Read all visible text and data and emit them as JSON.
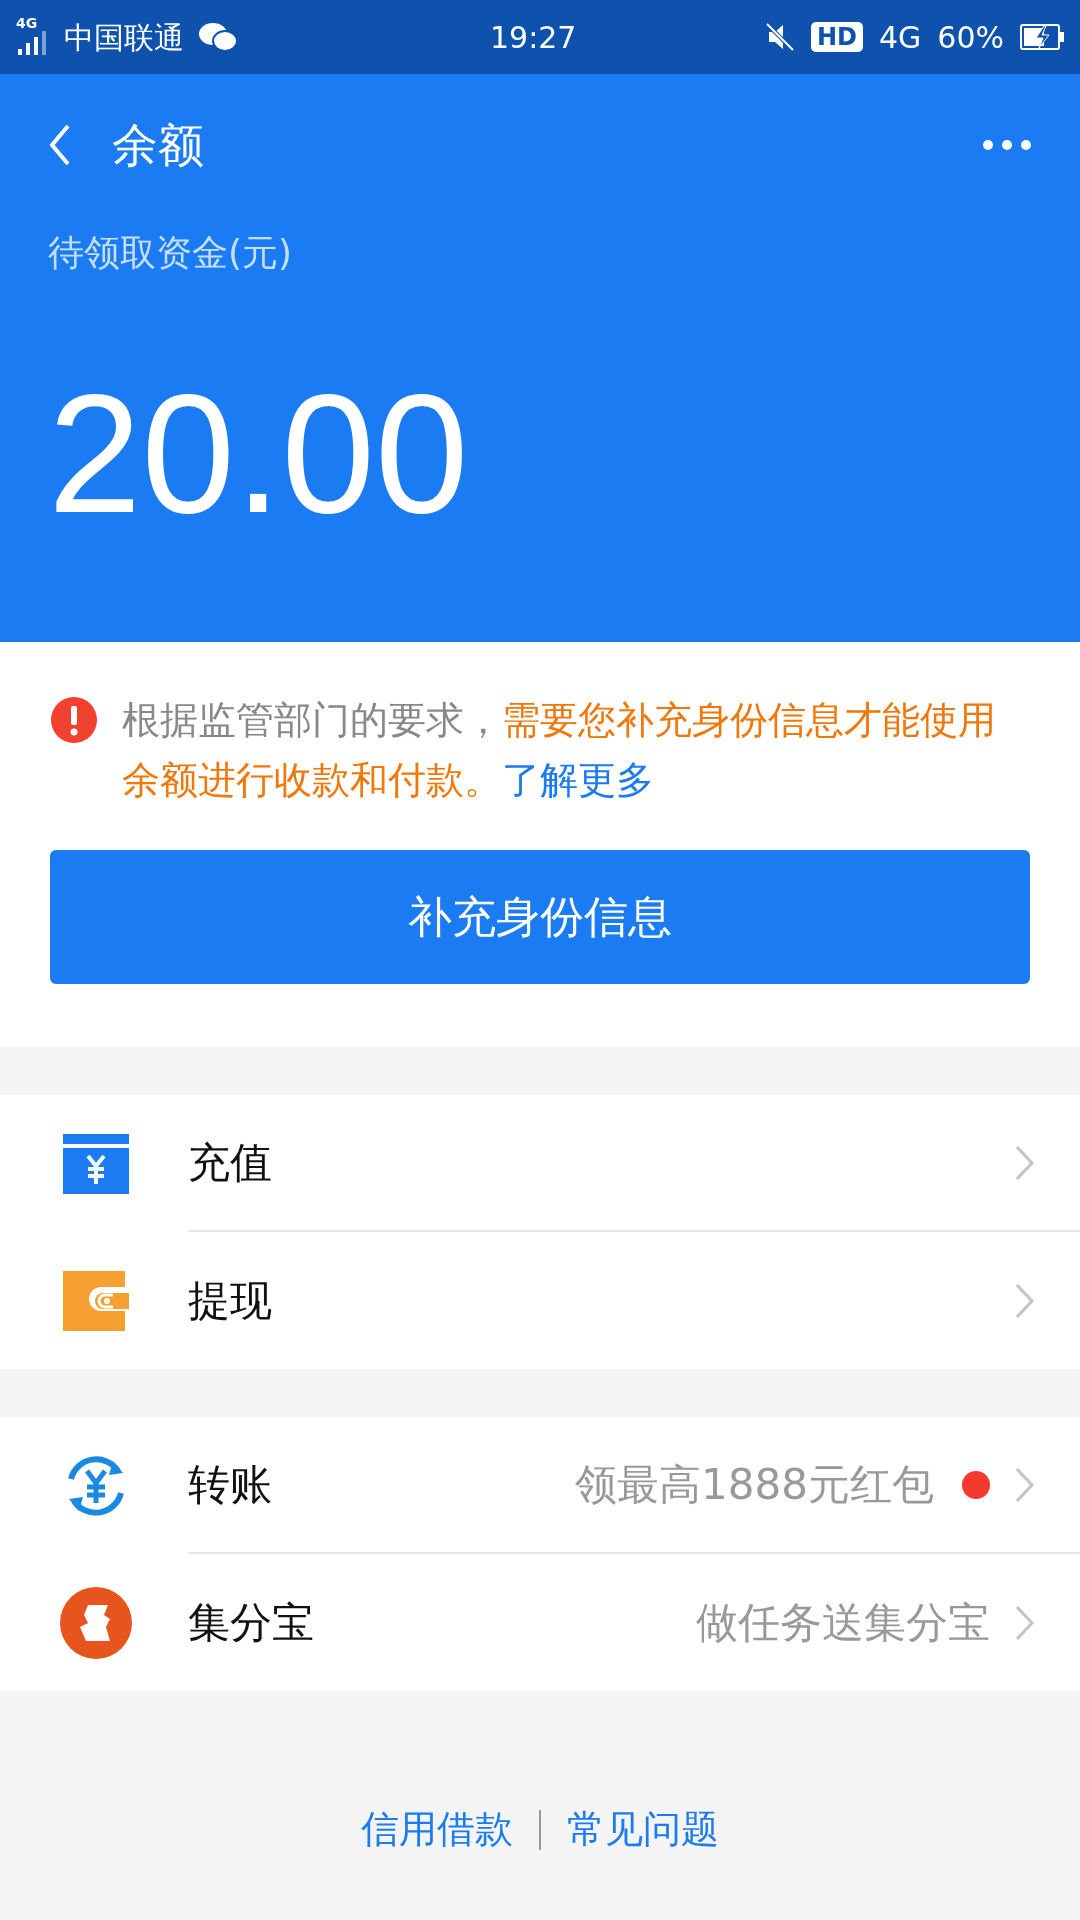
{
  "status_bar": {
    "signal_label": "4G",
    "carrier": "中国联通",
    "time": "19:27",
    "hd": "HD",
    "network": "4G",
    "battery": "60%"
  },
  "header": {
    "title": "余额",
    "balance_label": "待领取资金(元)",
    "balance": "20.00"
  },
  "notice": {
    "segments": [
      {
        "kind": "normal",
        "text": "根据监管部门的要求，"
      },
      {
        "kind": "warning",
        "text": "需要您补充身份信息才能使用余额进行收款和付款。"
      },
      {
        "kind": "link",
        "text": "了解更多"
      }
    ],
    "button": "补充身份信息"
  },
  "menu_groups": [
    [
      {
        "kind": "recharge",
        "label": "充值",
        "dot": false
      },
      {
        "kind": "withdraw",
        "label": "提现",
        "dot": false
      }
    ],
    [
      {
        "kind": "transfer",
        "label": "转账",
        "hint": "领最高1888元红包",
        "dot": true
      },
      {
        "kind": "points",
        "label": "集分宝",
        "hint": "做任务送集分宝",
        "dot": false
      }
    ]
  ],
  "footer_links": [
    "信用借款",
    "常见问题"
  ]
}
